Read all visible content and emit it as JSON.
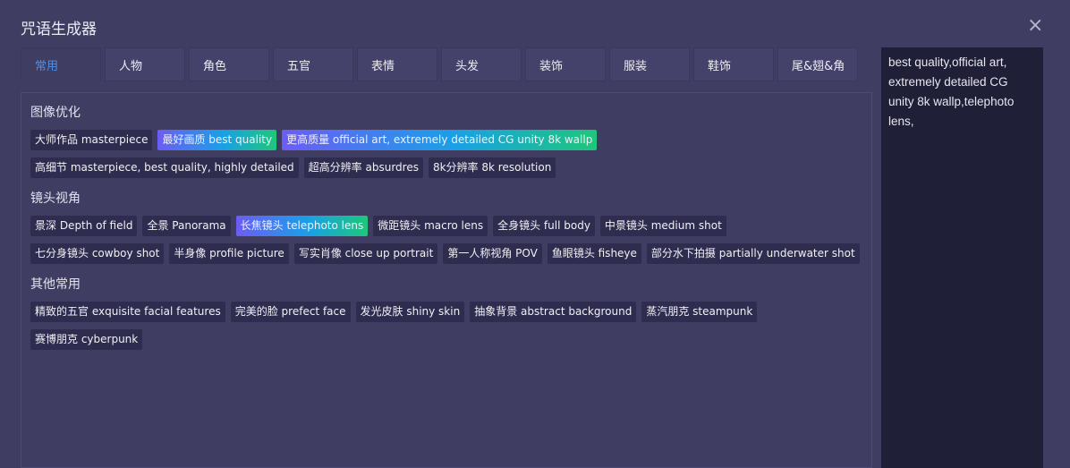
{
  "dialog": {
    "title": "咒语生成器",
    "close": "×"
  },
  "tabs": [
    "常用",
    "人物",
    "角色",
    "五官",
    "表情",
    "头发",
    "装饰",
    "服装",
    "鞋饰",
    "尾&翅&角"
  ],
  "sections": [
    {
      "title": "图像优化",
      "tags": [
        {
          "label": "大师作品 masterpiece",
          "selected": false
        },
        {
          "label": "最好画质 best quality",
          "selected": true
        },
        {
          "label": "更高质量 official art, extremely detailed CG unity 8k wallp",
          "selected": true
        },
        {
          "label": "高细节 masterpiece, best quality, highly detailed",
          "selected": false
        },
        {
          "label": "超高分辨率 absurdres",
          "selected": false
        },
        {
          "label": "8k分辨率 8k resolution",
          "selected": false
        }
      ]
    },
    {
      "title": "镜头视角",
      "tags": [
        {
          "label": "景深 Depth of field",
          "selected": false
        },
        {
          "label": "全景 Panorama",
          "selected": false
        },
        {
          "label": "长焦镜头 telephoto lens",
          "selected": true
        },
        {
          "label": "微距镜头 macro lens",
          "selected": false
        },
        {
          "label": "全身镜头 full body",
          "selected": false
        },
        {
          "label": "中景镜头 medium shot",
          "selected": false
        },
        {
          "label": "七分身镜头 cowboy shot",
          "selected": false
        },
        {
          "label": "半身像 profile picture",
          "selected": false
        },
        {
          "label": "写实肖像 close up portrait",
          "selected": false
        },
        {
          "label": "第一人称视角 POV",
          "selected": false
        },
        {
          "label": "鱼眼镜头 fisheye",
          "selected": false
        },
        {
          "label": "部分水下拍摄 partially underwater shot",
          "selected": false
        }
      ]
    },
    {
      "title": "其他常用",
      "tags": [
        {
          "label": "精致的五官 exquisite facial features",
          "selected": false
        },
        {
          "label": "完美的脸 prefect face",
          "selected": false
        },
        {
          "label": "发光皮肤 shiny skin",
          "selected": false
        },
        {
          "label": "抽象背景 abstract background",
          "selected": false
        },
        {
          "label": "蒸汽朋克 steampunk",
          "selected": false
        },
        {
          "label": "赛博朋克 cyberpunk",
          "selected": false
        }
      ]
    }
  ],
  "output": "best quality,official art, extremely detailed CG unity 8k wallp,telephoto lens,"
}
